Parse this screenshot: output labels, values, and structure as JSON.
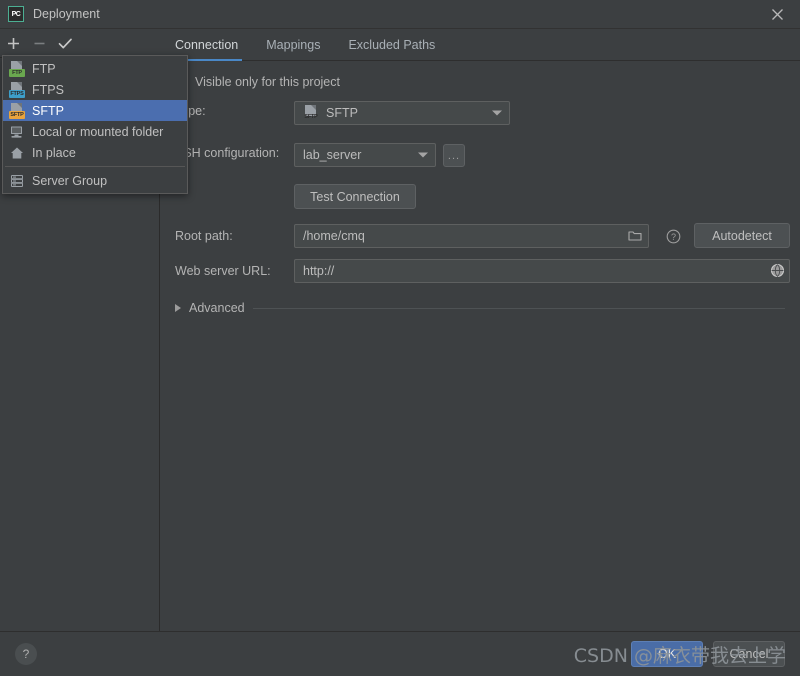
{
  "window": {
    "title": "Deployment",
    "app_icon_label": "PC",
    "close_icon": "close-icon"
  },
  "left_toolbar": {
    "add_label": "+",
    "remove_label": "−",
    "use_as_default_label": "✓"
  },
  "popup_menu": {
    "items": [
      {
        "label": "FTP",
        "icon": "ftp-icon",
        "badge": "FTP",
        "badge_color": "#6aa84f",
        "selected": false
      },
      {
        "label": "FTPS",
        "icon": "ftps-icon",
        "badge": "FTPS",
        "badge_color": "#3d9ec9",
        "selected": false
      },
      {
        "label": "SFTP",
        "icon": "sftp-icon",
        "badge": "SFTP",
        "badge_color": "#e8a33d",
        "selected": true
      },
      {
        "label": "Local or mounted folder",
        "icon": "folder-mounted-icon",
        "selected": false
      },
      {
        "label": "In place",
        "icon": "home-icon",
        "selected": false
      }
    ],
    "group_item": {
      "label": "Server Group",
      "icon": "server-group-icon"
    }
  },
  "tabs": [
    {
      "label": "Connection",
      "active": true
    },
    {
      "label": "Mappings",
      "active": false
    },
    {
      "label": "Excluded Paths",
      "active": false
    }
  ],
  "form": {
    "visible_only_checkbox": {
      "label": "Visible only for this project",
      "checked": false
    },
    "type": {
      "label": "Type:",
      "value": "SFTP",
      "icon": "sftp-icon",
      "badge": "SFTP",
      "badge_color": "#e8a33d"
    },
    "ssh_configuration": {
      "label": "SSH configuration:",
      "value": "lab_server",
      "browse_label": "..."
    },
    "test_connection_label": "Test Connection",
    "root_path": {
      "label": "Root path:",
      "value": "/home/cmq",
      "browse_icon": "folder-open-icon",
      "help_icon": "question-circle-icon",
      "autodetect_label": "Autodetect"
    },
    "web_server_url": {
      "label": "Web server URL:",
      "value": "http://",
      "open_icon": "globe-icon"
    },
    "advanced": {
      "label": "Advanced",
      "expanded": false,
      "chevron_icon": "triangle-right-icon"
    }
  },
  "bottom_bar": {
    "help_label": "?",
    "ok_label": "OK",
    "cancel_label": "Cancel"
  },
  "watermark": {
    "text": "CSDN @麻衣带我去上学"
  },
  "colors": {
    "background": "#3c3f41",
    "accent_blue": "#4b6eaf",
    "tab_underline": "#4a88c7",
    "field_background": "#45494a",
    "text": "#bbbbbb"
  }
}
